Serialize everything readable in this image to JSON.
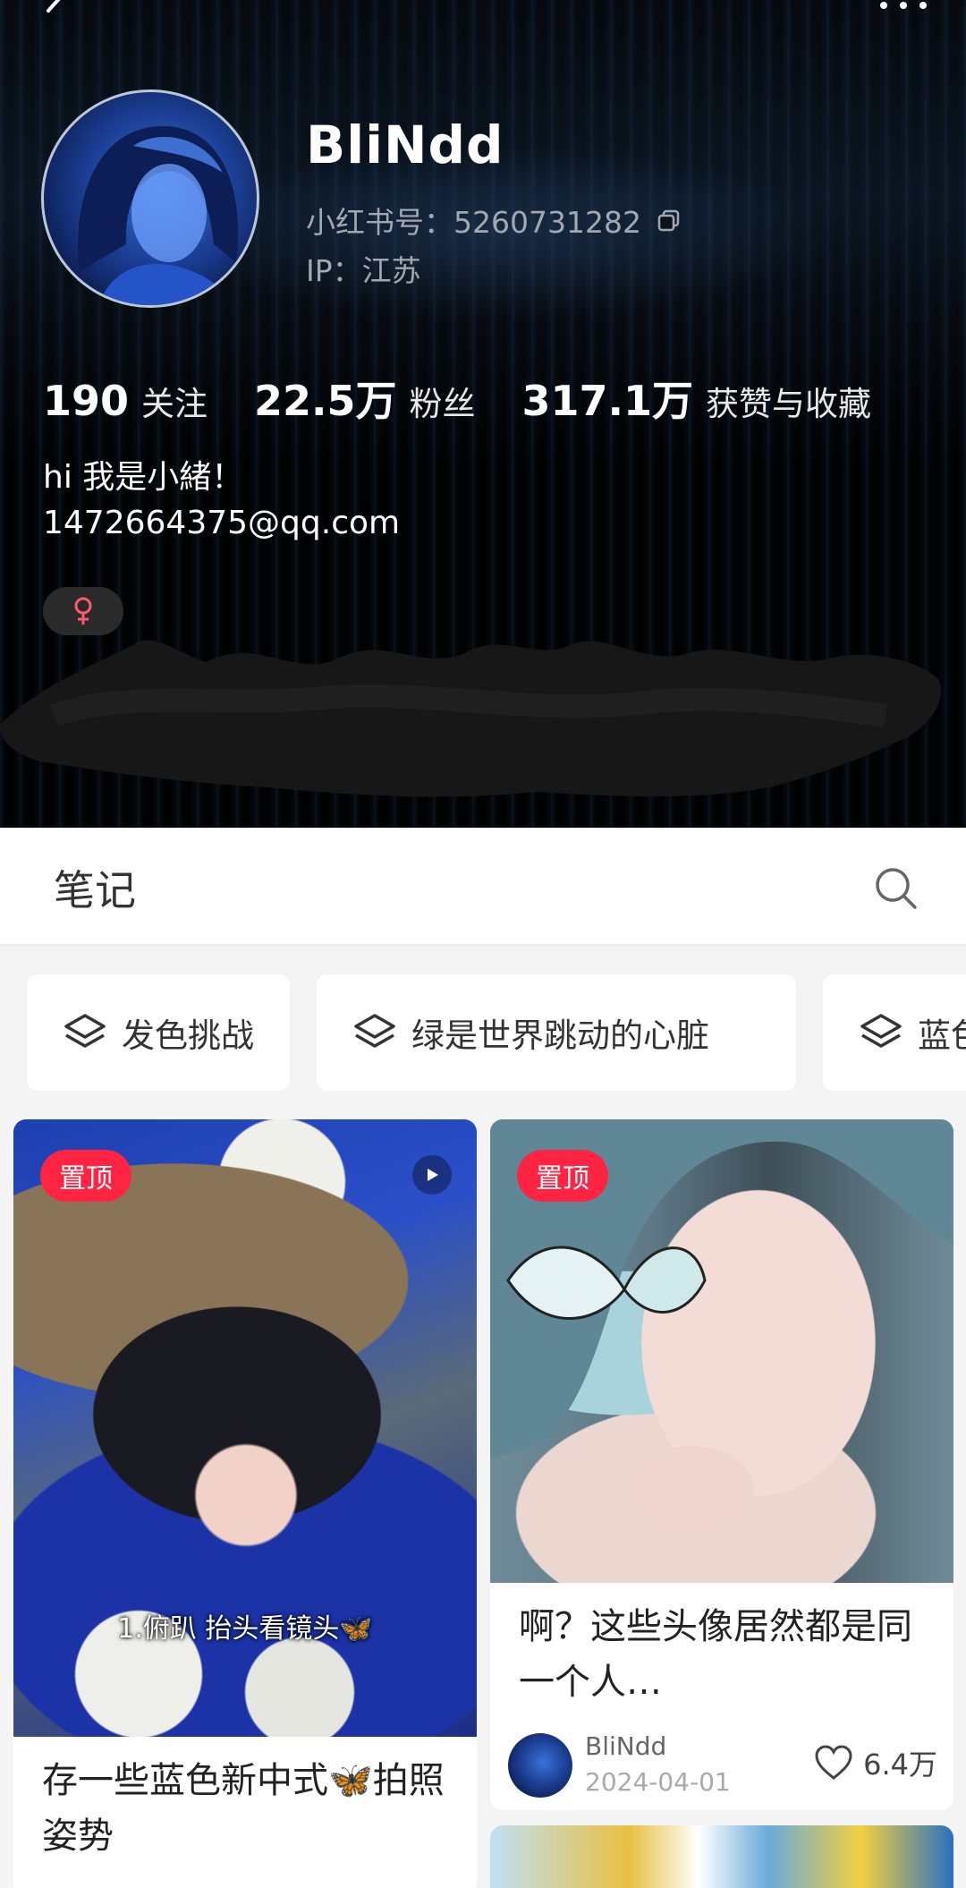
{
  "profile": {
    "username": "BliNdd",
    "xhs_id": "小红书号：5260731282",
    "ip": "IP：江苏",
    "bio_line1": "hi 我是小緒！",
    "bio_line2": "1472664375@qq.com",
    "gender_symbol": "♀",
    "gender_color": "#ff5a6a"
  },
  "stats": [
    {
      "value": "190",
      "label": "关注"
    },
    {
      "value": "22.5万",
      "label": "粉丝"
    },
    {
      "value": "317.1万",
      "label": "获赞与收藏"
    }
  ],
  "tabs": {
    "notes_label": "笔记"
  },
  "collections": [
    {
      "label": "发色挑战",
      "icon": "layers-icon"
    },
    {
      "label": "绿是世界跳动的心脏",
      "icon": "layers-icon"
    },
    {
      "label": "蓝色",
      "icon": "layers-icon"
    }
  ],
  "notes": [
    {
      "badge": "置顶",
      "overlay_caption": "1.俯趴 抬头看镜头🦋",
      "title": "存一些蓝色新中式🦋拍照姿势",
      "is_video": true
    },
    {
      "badge": "置顶",
      "title": "啊？这些头像居然都是同一个人…",
      "author": "BliNdd",
      "date": "2024-04-01",
      "likes": "6.4万"
    }
  ],
  "colors": {
    "accent": "#ff2442",
    "header_bg": "#000000",
    "page_bg": "#f4f4f4"
  }
}
